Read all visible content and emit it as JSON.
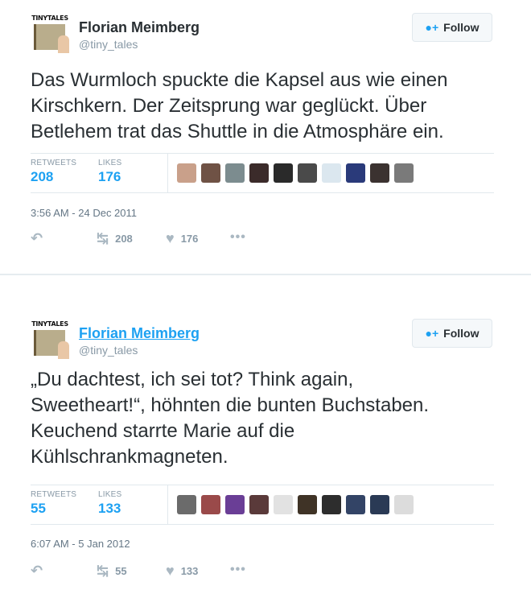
{
  "colors": {
    "accent": "#1da1f2",
    "muted": "#8899a6",
    "text": "#292f33"
  },
  "tweets": [
    {
      "avatar_logo": "TINYTALES",
      "fullname": "Florian Meimberg",
      "username": "@tiny_tales",
      "follow_label": "Follow",
      "text": "Das Wurmloch spuckte die Kapsel aus wie einen\nKirschkern. Der Zeitsprung war geglückt. Über\nBetlehem trat das Shuttle in die Atmosphäre ein.",
      "retweets_label": "RETWEETS",
      "retweets": "208",
      "likes_label": "LIKES",
      "likes": "176",
      "timestamp": "3:56 AM - 24 Dec 2011",
      "retweet_count": "208",
      "like_count": "176",
      "liker_avatar_colors": [
        "#c9a08a",
        "#6f5245",
        "#7c8c8f",
        "#3b2b2a",
        "#2a2a2a",
        "#4a4a4a",
        "#dbe7ef",
        "#2a3a7a",
        "#3b3230",
        "#7a7a7a"
      ]
    },
    {
      "avatar_logo": "TINYTALES",
      "fullname": "Florian Meimberg",
      "username": "@tiny_tales",
      "follow_label": "Follow",
      "text": "„Du dachtest, ich sei tot? Think again,\nSweetheart!“, höhnten die bunten Buchstaben.\nKeuchend starrte Marie auf die\nKühlschrankmagneten.",
      "retweets_label": "RETWEETS",
      "retweets": "55",
      "likes_label": "LIKES",
      "likes": "133",
      "timestamp": "6:07 AM - 5 Jan 2012",
      "retweet_count": "55",
      "like_count": "133",
      "liker_avatar_colors": [
        "#6b6b6b",
        "#9a4a4a",
        "#6a3e96",
        "#5a3a3a",
        "#e2e2e2",
        "#3f3326",
        "#2d2d2d",
        "#334466",
        "#2a3a55",
        "#dcdcdc"
      ]
    }
  ]
}
